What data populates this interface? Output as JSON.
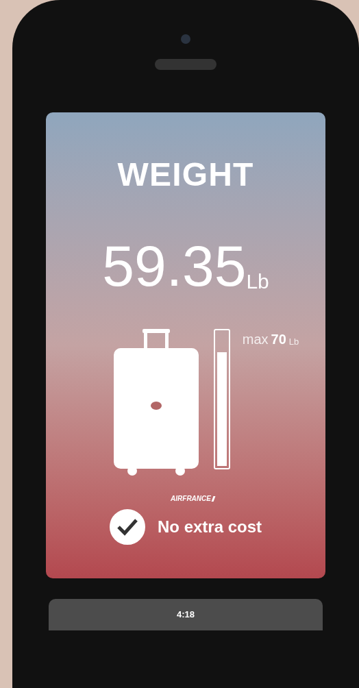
{
  "title": "WEIGHT",
  "weight": {
    "value": "59.35",
    "unit": "Lb"
  },
  "limit": {
    "prefix": "max",
    "value": "70",
    "unit": "Lb"
  },
  "meter": {
    "level": 0.85
  },
  "airline": "AIRFRANCE",
  "status": {
    "checked": true,
    "text": "No extra cost"
  },
  "bottom_bar": {
    "time": "4:18"
  }
}
